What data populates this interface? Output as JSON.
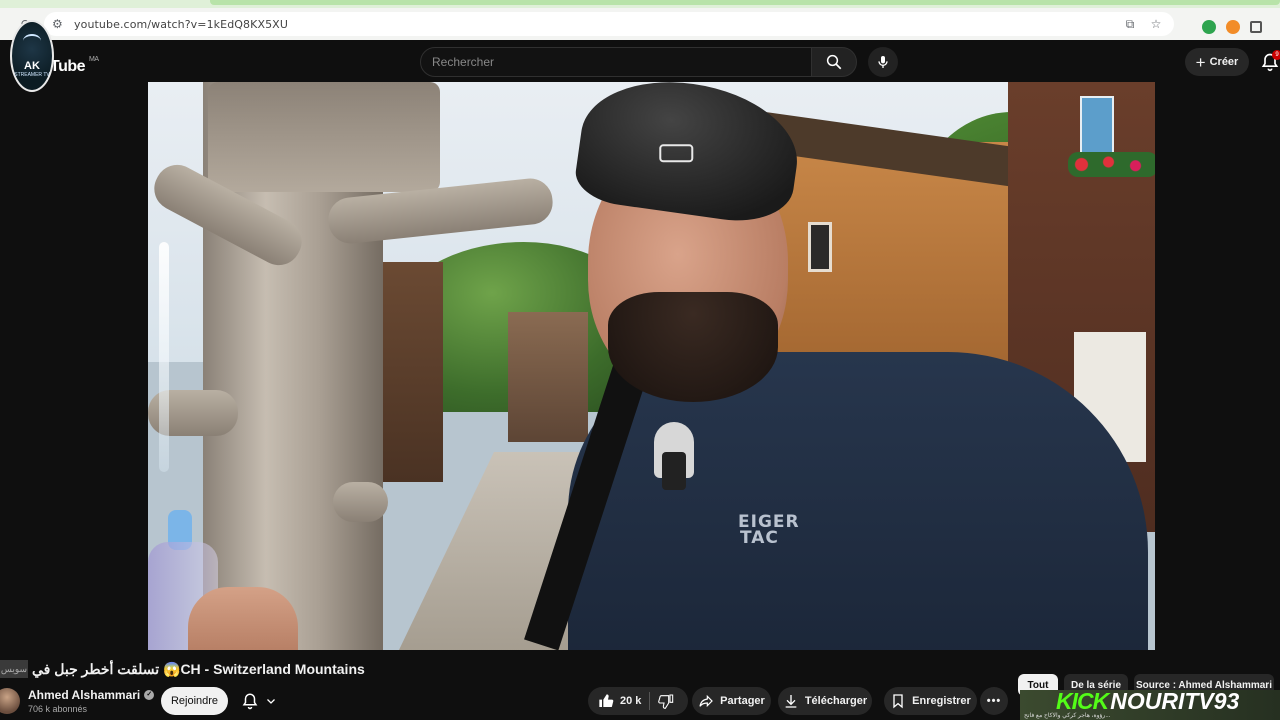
{
  "browser": {
    "url": "youtube.com/watch?v=1kEdQ8KX5XU"
  },
  "header": {
    "logo_text": "Tube",
    "region": "MA",
    "avatar_initials": "AK",
    "avatar_subtext": "STREAMER TV",
    "search_placeholder": "Rechercher",
    "create_label": "Créer",
    "notification_count": "9"
  },
  "video": {
    "shirt_logo_line1": "EIGER",
    "shirt_logo_line2": "TAC"
  },
  "info": {
    "title": "تسلقت أخطر جبل في 😱CH - Switzerland Mountains",
    "title_tag": "سويس",
    "channel_name": "Ahmed Alshammari",
    "subscribers": "706 k abonnés",
    "join_label": "Rejoindre",
    "likes": "20 k",
    "share_label": "Partager",
    "download_label": "Télécharger",
    "save_label": "Enregistrer",
    "more_label": "•••"
  },
  "chips": [
    {
      "label": "Tout"
    },
    {
      "label": "De la série"
    },
    {
      "label": "Source : Ahmed Alshammari"
    }
  ],
  "overlay": {
    "kick": "KICK",
    "handle": "NOURITV93",
    "ticker": "رؤوة، هاجر كركي والاكاح مع فاتح..."
  },
  "colors": {
    "background": "#0f0f0f",
    "kick_green": "#53fc18",
    "pill": "#272727"
  }
}
